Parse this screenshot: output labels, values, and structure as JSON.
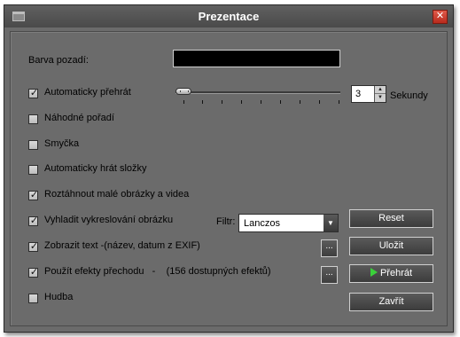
{
  "window": {
    "title": "Prezentace"
  },
  "background": {
    "label": "Barva pozadí:",
    "color": "#000000"
  },
  "autoplay": {
    "label": "Automaticky přehrát",
    "checked": true,
    "slider_level": 0.0,
    "seconds_value": "3",
    "seconds_label": "Sekundy"
  },
  "options": {
    "random": {
      "label": "Náhodné pořadí",
      "checked": false
    },
    "loop": {
      "label": "Smyčka",
      "checked": false
    },
    "folders": {
      "label": "Automaticky hrát složky",
      "checked": false
    },
    "stretch": {
      "label": "Roztáhnout malé obrázky a videa",
      "checked": true
    },
    "smooth": {
      "label": "Vyhladit vykreslování obrázku",
      "checked": true
    },
    "showtext": {
      "label": "Zobrazit text -(název, datum z EXIF)",
      "checked": true
    },
    "effects": {
      "label": "Použít efekty přechodu   -    (156 dostupných efektů)",
      "checked": true
    },
    "music": {
      "label": "Hudba",
      "checked": false
    }
  },
  "filter": {
    "label": "Filtr:",
    "value": "Lanczos"
  },
  "buttons": {
    "reset": "Reset",
    "save": "Uložit",
    "play": "Přehrát",
    "close": "Zavřít",
    "more": "..."
  },
  "colors": {
    "window_bg": "#6b6b6b",
    "play_accent": "#3ad13a",
    "close_red": "#d0402f"
  }
}
